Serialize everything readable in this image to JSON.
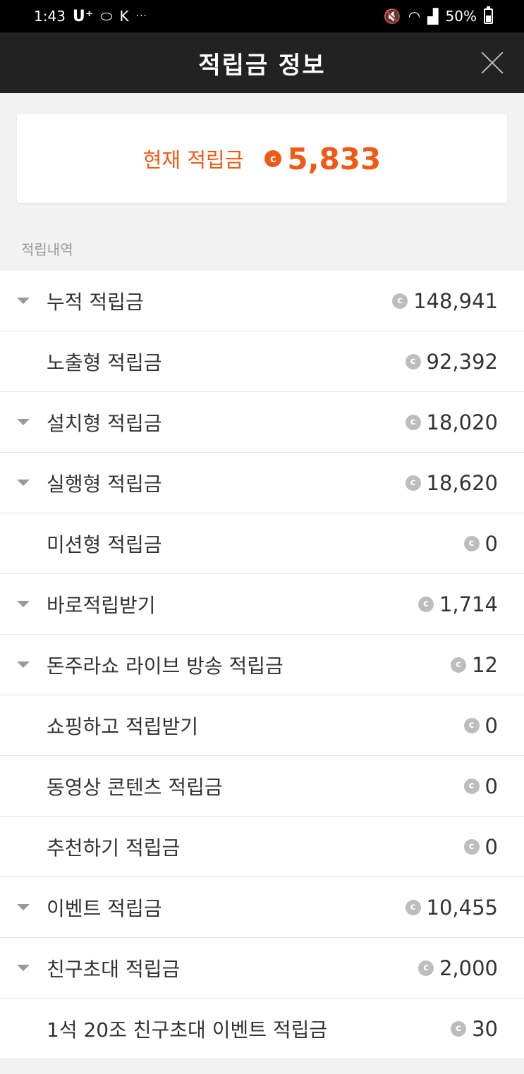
{
  "status_bar": {
    "time": "1:43",
    "carrier": "U⁺",
    "dots": "···",
    "battery": "50%"
  },
  "header": {
    "title": "적립금 정보"
  },
  "balance": {
    "label": "현재 적립금",
    "coin_symbol": "c",
    "value": "5,833"
  },
  "history": {
    "section_label": "적립내역",
    "coin_symbol": "c",
    "items": [
      {
        "label": "누적 적립금",
        "amount": "148,941",
        "expandable": true
      },
      {
        "label": "노출형 적립금",
        "amount": "92,392",
        "expandable": false
      },
      {
        "label": "설치형 적립금",
        "amount": "18,020",
        "expandable": true
      },
      {
        "label": "실행형 적립금",
        "amount": "18,620",
        "expandable": true
      },
      {
        "label": "미션형 적립금",
        "amount": "0",
        "expandable": false
      },
      {
        "label": "바로적립받기",
        "amount": "1,714",
        "expandable": true
      },
      {
        "label": "돈주라쇼 라이브 방송 적립금",
        "amount": "12",
        "expandable": true
      },
      {
        "label": "쇼핑하고 적립받기",
        "amount": "0",
        "expandable": false
      },
      {
        "label": "동영상 콘텐츠 적립금",
        "amount": "0",
        "expandable": false
      },
      {
        "label": "추천하기 적립금",
        "amount": "0",
        "expandable": false
      },
      {
        "label": "이벤트 적립금",
        "amount": "10,455",
        "expandable": true
      },
      {
        "label": "친구초대 적립금",
        "amount": "2,000",
        "expandable": true
      },
      {
        "label": "1석 20조 친구초대 이벤트 적립금",
        "amount": "30",
        "expandable": false
      }
    ]
  },
  "colors": {
    "accent": "#f05a14",
    "header_bg": "#222222",
    "coin_gray": "#bdbdbd"
  }
}
